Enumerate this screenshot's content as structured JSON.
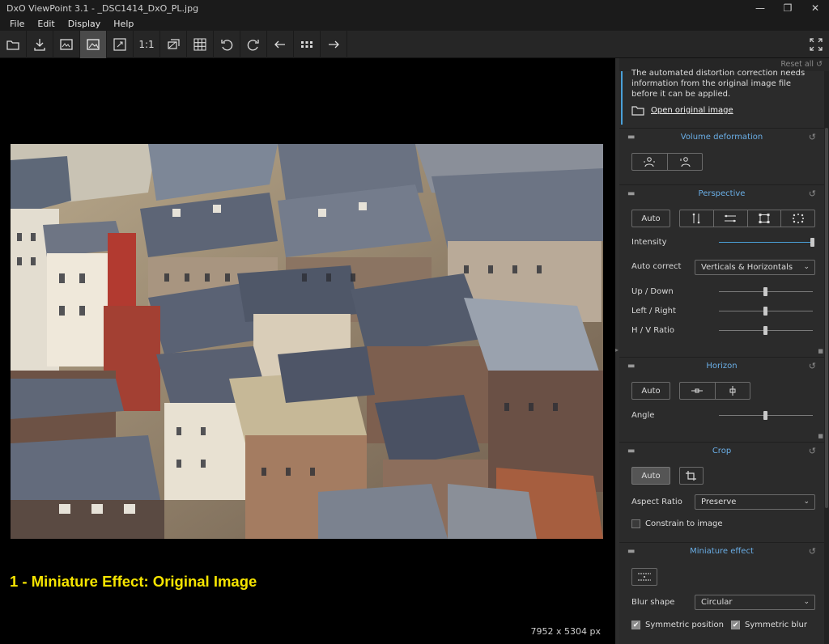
{
  "window": {
    "title": "DxO ViewPoint 3.1 - _DSC1414_DxO_PL.jpg"
  },
  "menu": [
    {
      "label": "File"
    },
    {
      "label": "Edit"
    },
    {
      "label": "Display"
    },
    {
      "label": "Help"
    }
  ],
  "toolbar": {
    "zoom_label": "1:1"
  },
  "viewer": {
    "caption": "1 - Miniature Effect: Original Image",
    "dimensions": "7952 x 5304 px"
  },
  "panel": {
    "reset_all": "Reset all",
    "info": {
      "message": "The automated distortion correction needs information from the original image file before it can be applied.",
      "open_link": "Open original image"
    },
    "volume": {
      "title": "Volume deformation"
    },
    "perspective": {
      "title": "Perspective",
      "auto": "Auto",
      "intensity_label": "Intensity",
      "intensity_value": 1.0,
      "auto_correct_label": "Auto correct",
      "auto_correct_value": "Verticals & Horizontals",
      "updown_label": "Up / Down",
      "updown_value": 0.5,
      "leftright_label": "Left / Right",
      "leftright_value": 0.5,
      "hv_label": "H / V Ratio",
      "hv_value": 0.5
    },
    "horizon": {
      "title": "Horizon",
      "auto": "Auto",
      "angle_label": "Angle",
      "angle_value": 0.5
    },
    "crop": {
      "title": "Crop",
      "auto": "Auto",
      "aspect_label": "Aspect Ratio",
      "aspect_value": "Preserve",
      "constrain_label": "Constrain to image",
      "constrain_checked": false
    },
    "miniature": {
      "title": "Miniature effect",
      "blur_label": "Blur shape",
      "blur_value": "Circular",
      "sym_pos_label": "Symmetric position",
      "sym_pos_checked": true,
      "sym_blur_label": "Symmetric blur",
      "sym_blur_checked": true
    }
  },
  "colors": {
    "accent": "#4aa0d8",
    "caption": "#f5e400",
    "panel_bg": "#2b2b2b"
  }
}
